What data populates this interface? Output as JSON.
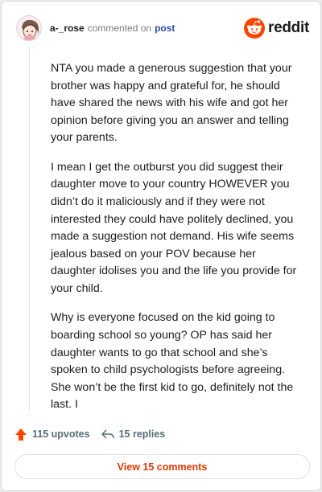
{
  "header": {
    "username": "a-_rose",
    "verb": "commented on",
    "post_link": "post",
    "brand": "reddit",
    "brand_color": "#ff4500",
    "avatar_icon": "snoo-avatar-icon"
  },
  "comment": {
    "paragraphs": [
      "NTA you made a generous suggestion that your brother was happy and grateful for, he should have shared the news with his wife and got her opinion before giving you an answer and telling your parents.",
      "I mean I get the outburst you did suggest their daughter move to your country HOWEVER you didn’t do it maliciously and if they were not interested they could have politely declined, you made a suggestion not demand. His wife seems jealous based on your POV because her daughter idolises you and the life you provide for your child.",
      "Why is everyone focused on the kid going to boarding school so young? OP has said her daughter wants to go that school and she’s spoken to child psychologists before agreeing. She won’t be the first kid to go, definitely not the last. I"
    ]
  },
  "actions": {
    "upvotes": "115 upvotes",
    "replies": "15 replies",
    "upvote_icon": "upvote-arrow-icon",
    "reply_icon": "reply-arrow-icon",
    "upvote_color": "#ff4500"
  },
  "footer": {
    "view_comments": "View 15 comments"
  }
}
